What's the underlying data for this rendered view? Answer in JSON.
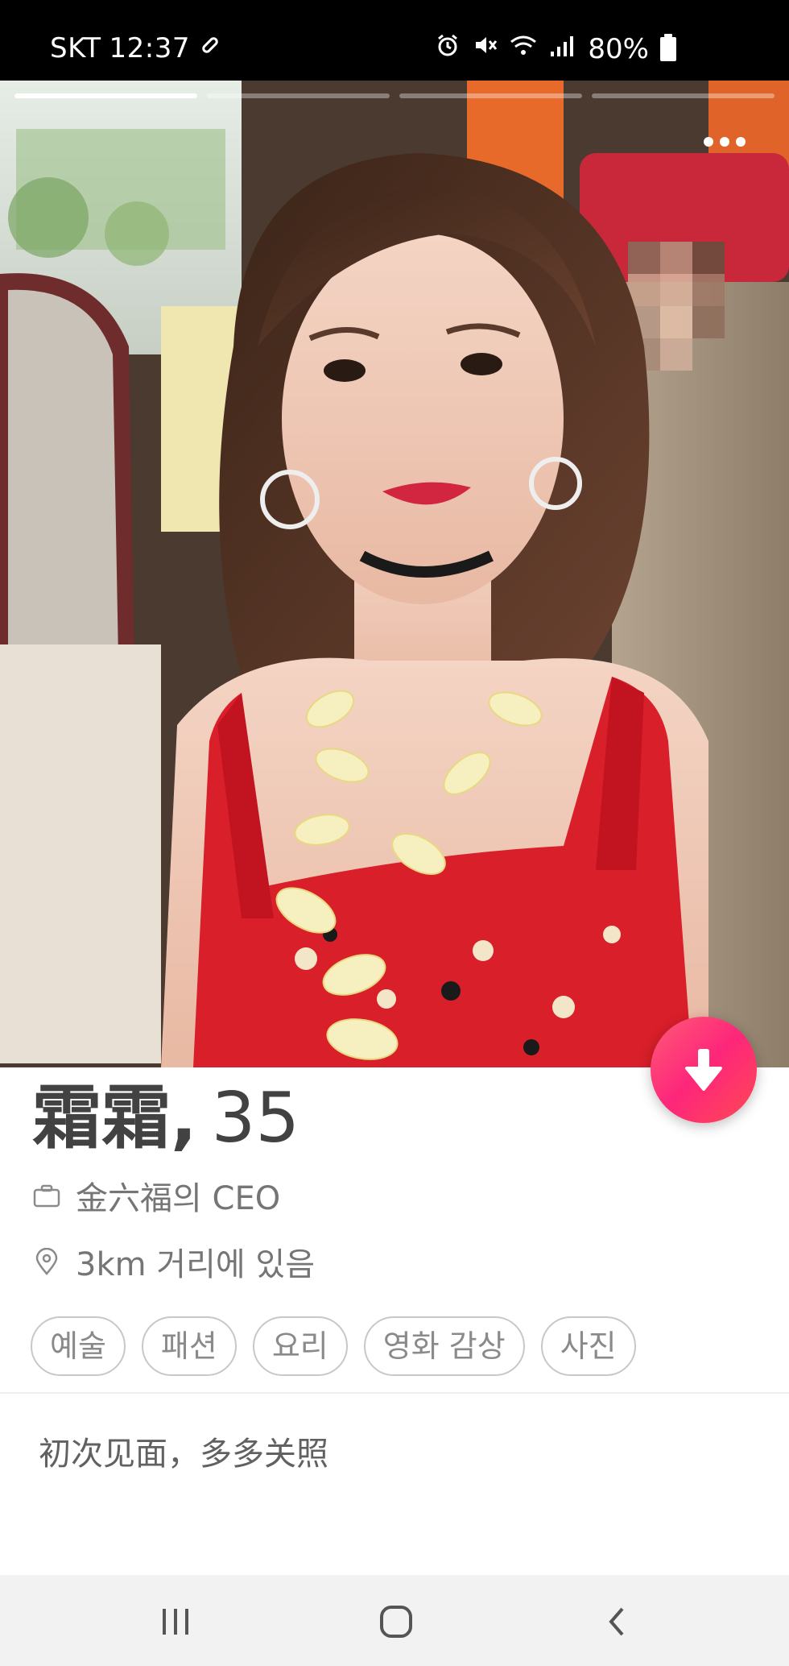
{
  "status_bar": {
    "carrier": "SKT",
    "time": "12:37",
    "battery": "80%",
    "icons": [
      "key-icon",
      "alarm-icon",
      "mute-icon",
      "wifi-icon",
      "signal-icon",
      "battery-icon"
    ]
  },
  "photo": {
    "description_icon": "profile-photo",
    "progress_segments": 4,
    "active_segment": 1
  },
  "profile": {
    "name": "霜霜",
    "comma": ",",
    "age": "35",
    "job": "金六福의 CEO",
    "distance": "3km 거리에 있음"
  },
  "tags": [
    "예술",
    "패션",
    "요리",
    "영화 감상",
    "사진"
  ],
  "bio": "初次见面，多多关照",
  "colors": {
    "accent_gradient_start": "#ff5a77",
    "accent_gradient_end": "#fd267a",
    "text_primary": "#424242",
    "text_secondary": "#757575"
  },
  "nav": {
    "icons": [
      "recent-apps-icon",
      "home-icon",
      "back-icon"
    ]
  }
}
